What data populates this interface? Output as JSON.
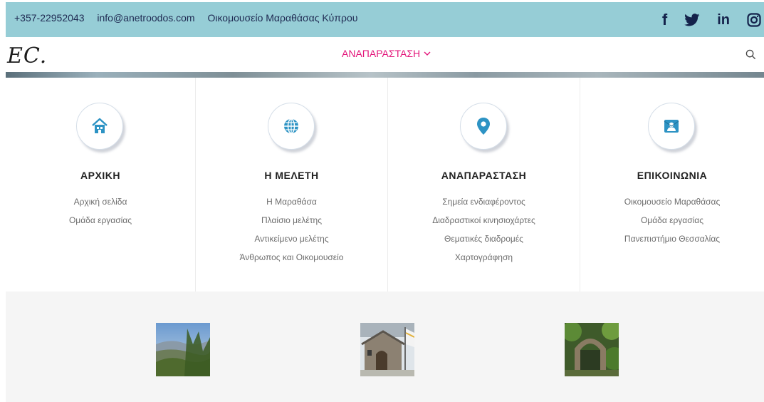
{
  "topbar": {
    "phone": "+357-22952043",
    "email": "info@anetroodos.com",
    "museum": "Οικομουσείο Μαραθάσας Κύπρου",
    "social_icons": [
      "facebook-icon",
      "twitter-icon",
      "linkedin-icon",
      "instagram-icon"
    ],
    "facebook_glyph": "f",
    "linkedin_glyph": "in",
    "background": "#96cdd6",
    "text_color": "#1f2a52"
  },
  "navbar": {
    "logo": "EC.",
    "active_item": "ΑΝΑΠΑΡΑΣΤΑΣΗ",
    "accent_color": "#e3157a",
    "search_icon": "search-icon"
  },
  "menu": {
    "columns": [
      {
        "icon": "home-icon",
        "title": "ΑΡΧΙΚΗ",
        "links": [
          "Αρχική σελίδα",
          "Ομάδα εργασίας"
        ]
      },
      {
        "icon": "globe-icon",
        "title": "Η ΜΕΛΕΤΗ",
        "links": [
          "Η Μαραθάσα",
          "Πλαίσιο μελέτης",
          "Αντικείμενο μελέτης",
          "Άνθρωπος και Οικομουσείο"
        ]
      },
      {
        "icon": "map-pin-icon",
        "title": "ΑΝΑΠΑΡΑΣΤΑΣΗ",
        "links": [
          "Σημεία ενδιαφέροντος",
          "Διαδραστικοί κινησιοχάρτες",
          "Θεματικές διαδρομές",
          "Χαρτογράφηση"
        ]
      },
      {
        "icon": "contact-icon",
        "title": "ΕΠΙΚΟΙΝΩΝΙΑ",
        "links": [
          "Οικομουσείο Μαραθάσας",
          "Ομάδα εργασίας",
          "Πανεπιστήμιο Θεσσαλίας"
        ]
      }
    ],
    "icon_color": "#2d93c4"
  },
  "gallery": {
    "thumbnails": [
      "landscape-photo",
      "chapel-photo",
      "stone-arch-photo"
    ]
  }
}
